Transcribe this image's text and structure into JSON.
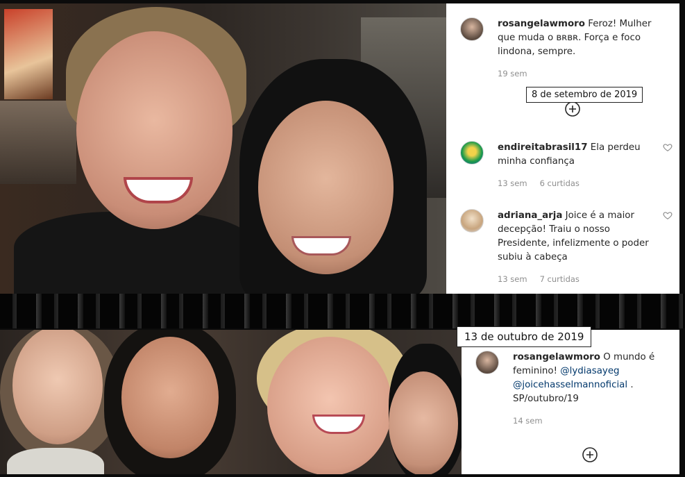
{
  "top_post": {
    "comments": [
      {
        "username": "rosangelawmoro",
        "text": "Feroz! Mulher que muda o ʙʀʙʀ. Força e foco lindona, sempre.",
        "time": "19 sem",
        "likes": ""
      },
      {
        "username": "endireitabrasil17",
        "text": "Ela perdeu minha confiança",
        "time": "13 sem",
        "likes": "6 curtidas"
      },
      {
        "username": "adriana_arja",
        "text": "Joice é a maior decepção! Traiu o nosso Presidente, infelizmente o poder subiu à cabeça",
        "time": "13 sem",
        "likes": "7 curtidas"
      }
    ],
    "date_label": "8 de setembro de 2019",
    "load_more_icon": "plus-circle-icon"
  },
  "bottom_post": {
    "date_label": "13 de outubro de 2019",
    "comment": {
      "username": "rosangelawmoro",
      "text_before": "O mundo é feminino!",
      "mention1": "@lydiasayeg",
      "mention2": "@joicehasselmannoficial",
      "text_after": ". SP/outubro/19",
      "time": "14 sem"
    },
    "load_more_icon": "plus-circle-icon"
  },
  "colors": {
    "username": "#262626",
    "meta": "#8e8e8e",
    "mention": "#00376b",
    "background": "#0b0b0b"
  }
}
